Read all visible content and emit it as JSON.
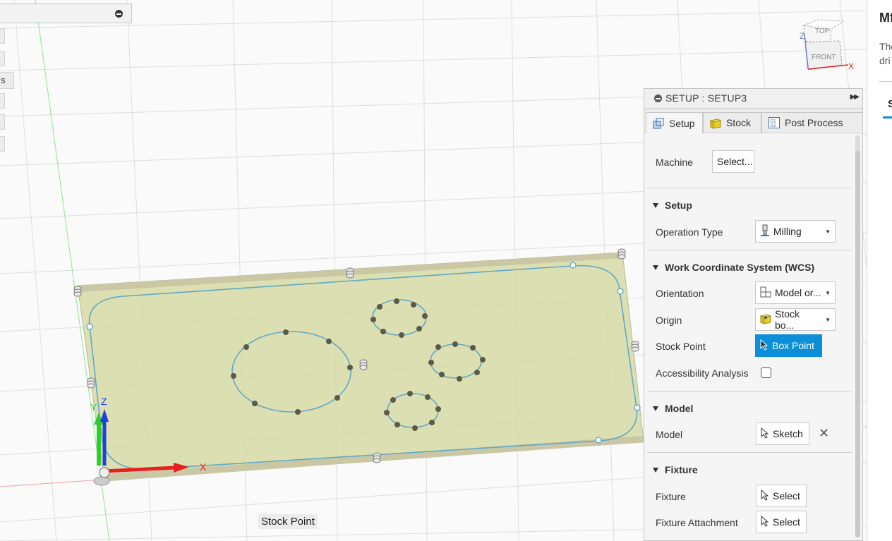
{
  "viewport": {
    "stock_point_tooltip": "Stock Point",
    "triad": {
      "x": "X",
      "y": "Y",
      "z": "Z"
    },
    "viewcube": {
      "top": "TOP",
      "front": "FRONT",
      "x": "X",
      "z": "Z"
    },
    "side_stub_text": "s"
  },
  "panel": {
    "title": "SETUP : SETUP3",
    "tabs": [
      {
        "label": "Setup",
        "icon": "setup-icon"
      },
      {
        "label": "Stock",
        "icon": "stock-cube-icon"
      },
      {
        "label": "Post Process",
        "icon": "gcode-icon"
      }
    ],
    "machine": {
      "label": "Machine",
      "button": "Select..."
    },
    "setup_section": {
      "title": "Setup",
      "operation_type": {
        "label": "Operation Type",
        "value": "Milling"
      }
    },
    "wcs_section": {
      "title": "Work Coordinate System (WCS)",
      "orientation": {
        "label": "Orientation",
        "value": "Model or..."
      },
      "origin": {
        "label": "Origin",
        "value": "Stock bo..."
      },
      "stock_point": {
        "label": "Stock Point",
        "value": "Box Point"
      },
      "accessibility": {
        "label": "Accessibility Analysis",
        "checked": false
      }
    },
    "model_section": {
      "title": "Model",
      "model": {
        "label": "Model",
        "value": "Sketch"
      }
    },
    "fixture_section": {
      "title": "Fixture",
      "fixture": {
        "label": "Fixture",
        "value": "Select"
      },
      "fixture_attachment": {
        "label": "Fixture Attachment",
        "value": "Select"
      }
    }
  },
  "help": {
    "title": "Mf",
    "text_line1": "The",
    "text_line2": "dri",
    "tab": "S"
  },
  "colors": {
    "accent": "#0b8fd8",
    "stock_fill": "#d9dca8",
    "sketch_line": "#5fa9c6",
    "axis_x": "#e62020",
    "axis_y": "#2ecc2e",
    "axis_z": "#1f3fe0"
  }
}
